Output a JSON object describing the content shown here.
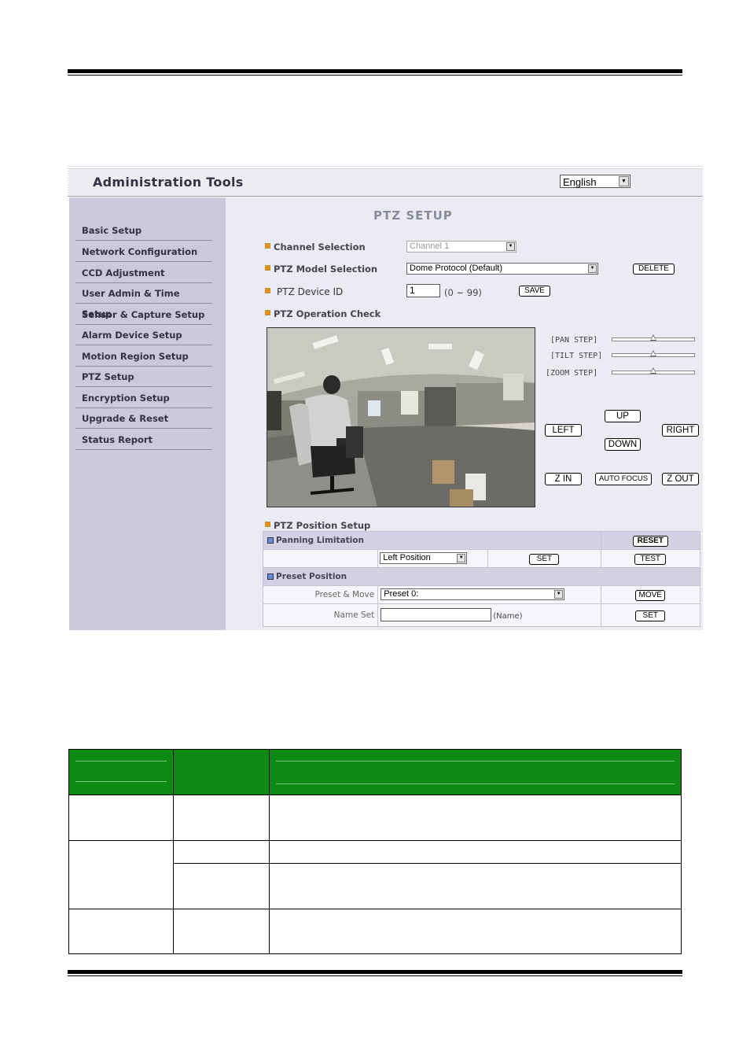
{
  "app": {
    "title": "Administration Tools",
    "language": "English"
  },
  "sidebar": {
    "items": [
      {
        "label": "Basic Setup"
      },
      {
        "label": "Network Configuration"
      },
      {
        "label": "CCD Adjustment"
      },
      {
        "label": "User Admin & Time Setup"
      },
      {
        "label": "Sensor & Capture Setup"
      },
      {
        "label": "Alarm Device Setup"
      },
      {
        "label": "Motion Region Setup"
      },
      {
        "label": "PTZ Setup"
      },
      {
        "label": "Encryption Setup"
      },
      {
        "label": "Upgrade & Reset"
      },
      {
        "label": "Status Report"
      }
    ]
  },
  "page": {
    "title": "PTZ SETUP",
    "channel_label": "Channel Selection",
    "channel_value": "Channel 1",
    "model_label": "PTZ Model Selection",
    "model_value": "Dome Protocol (Default)",
    "delete_label": "DELETE",
    "device_id_label": "PTZ Device ID",
    "device_id_value": "1",
    "device_id_range": "(0 ~ 99)",
    "save_label": "SAVE",
    "operation_label": "PTZ Operation Check",
    "pan_step_label": "[PAN STEP]",
    "tilt_step_label": "[TILT STEP]",
    "zoom_step_label": "[ZOOM STEP]",
    "pan_step": 0.5,
    "tilt_step": 0.5,
    "zoom_step": 0.5,
    "controls": {
      "up": "UP",
      "left": "LEFT",
      "right": "RIGHT",
      "down": "DOWN",
      "zoom_in": "Z IN",
      "auto_focus": "AUTO FOCUS",
      "zoom_out": "Z OUT"
    },
    "position_setup_label": "PTZ Position Setup",
    "panning_label": "Panning Limitation",
    "reset_label": "RESET",
    "position_value": "Left Position",
    "set_label": "SET",
    "test_label": "TEST",
    "preset_label": "Preset Position",
    "preset_move_label": "Preset & Move",
    "preset_value": "Preset 0:",
    "move_label": "MOVE",
    "name_set_label": "Name Set",
    "name_value": "",
    "name_hint": "(Name)",
    "set2_label": "SET"
  },
  "colors": {
    "sidebar": "#c9c9db",
    "main": "#ebebf4",
    "header_green": "#0d8a14",
    "section_icon": "#ff8a00"
  }
}
